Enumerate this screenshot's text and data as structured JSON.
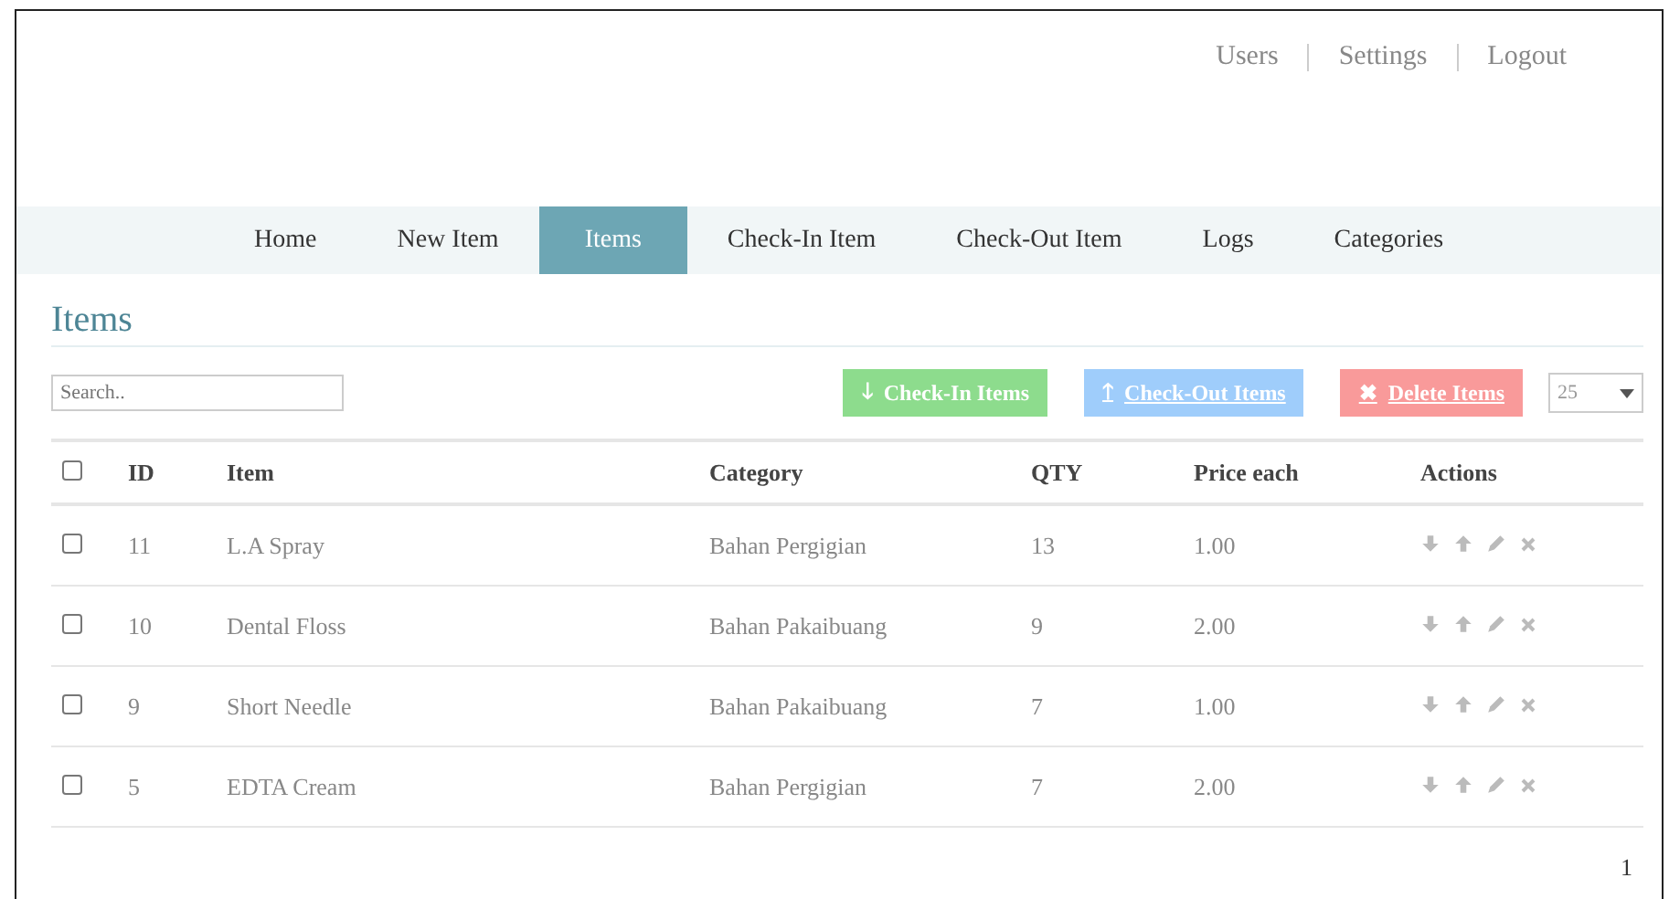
{
  "top_links": [
    "Users",
    "Settings",
    "Logout"
  ],
  "nav": [
    {
      "label": "Home",
      "selected": false
    },
    {
      "label": "New Item",
      "selected": false
    },
    {
      "label": "Items",
      "selected": true
    },
    {
      "label": "Check-In Item",
      "selected": false
    },
    {
      "label": "Check-Out Item",
      "selected": false
    },
    {
      "label": "Logs",
      "selected": false
    },
    {
      "label": "Categories",
      "selected": false
    }
  ],
  "page_title": "Items",
  "search": {
    "placeholder": "Search.."
  },
  "actions": [
    {
      "kind": "checkin",
      "label": "Check-In Items",
      "icon": "🡓"
    },
    {
      "kind": "checkout",
      "label": "Check-Out Items",
      "icon": "🡑"
    },
    {
      "kind": "delete",
      "label": "Delete Items",
      "icon": "✖"
    }
  ],
  "page_size": "25",
  "table": {
    "header_checked": false,
    "columns": [
      "ID",
      "Item",
      "Category",
      "QTY",
      "Price each",
      "Actions"
    ],
    "rows": [
      {
        "checked": false,
        "cells": [
          "11",
          "L.A Spray",
          "Bahan Pergigian",
          "13",
          "1.00"
        ]
      },
      {
        "checked": false,
        "cells": [
          "10",
          "Dental Floss",
          "Bahan Pakaibuang",
          "9",
          "2.00"
        ]
      },
      {
        "checked": false,
        "cells": [
          "9",
          "Short Needle",
          "Bahan Pakaibuang",
          "7",
          "1.00"
        ]
      },
      {
        "checked": false,
        "cells": [
          "5",
          "EDTA Cream",
          "Bahan Pergigian",
          "7",
          "2.00"
        ]
      }
    ]
  },
  "pagination": [
    "1"
  ]
}
